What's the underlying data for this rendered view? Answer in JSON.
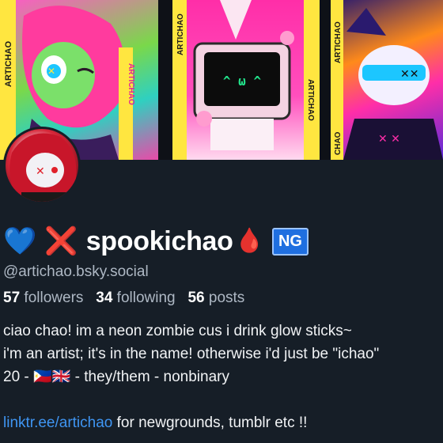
{
  "banner": {
    "artworks": [
      {
        "name": "art-zombie",
        "label_top": "ARTICHAO",
        "label_side": "4LY"
      },
      {
        "name": "art-tv",
        "label_top": "ARTICHAO",
        "label_side": "4LY",
        "face": "^ ω ^"
      },
      {
        "name": "art-cat",
        "label_top": "ARTICHAO",
        "label_side": "CHAO"
      }
    ]
  },
  "profile": {
    "display_name": "spookichao",
    "name_emojis": [
      "💙",
      "❌",
      "🩸"
    ],
    "badge": "NG",
    "handle": "@artichao.bsky.social",
    "stats": {
      "followers_count": "57",
      "followers_label": "followers",
      "following_count": "34",
      "following_label": "following",
      "posts_count": "56",
      "posts_label": "posts"
    },
    "bio_lines": [
      "ciao chao! im a neon zombie cus i drink glow sticks~",
      "i'm an artist; it's in the name! otherwise i'd just be \"ichao\"",
      "20 - 🇵🇭🇬🇧 - they/them - nonbinary",
      ""
    ],
    "link_text": "linktr.ee/artichao",
    "link_suffix": " for newgrounds, tumblr etc !!"
  },
  "colors": {
    "background": "#161e27",
    "link": "#3f95f2",
    "muted": "#aeb8c4",
    "badge": "#1f6fe0"
  }
}
